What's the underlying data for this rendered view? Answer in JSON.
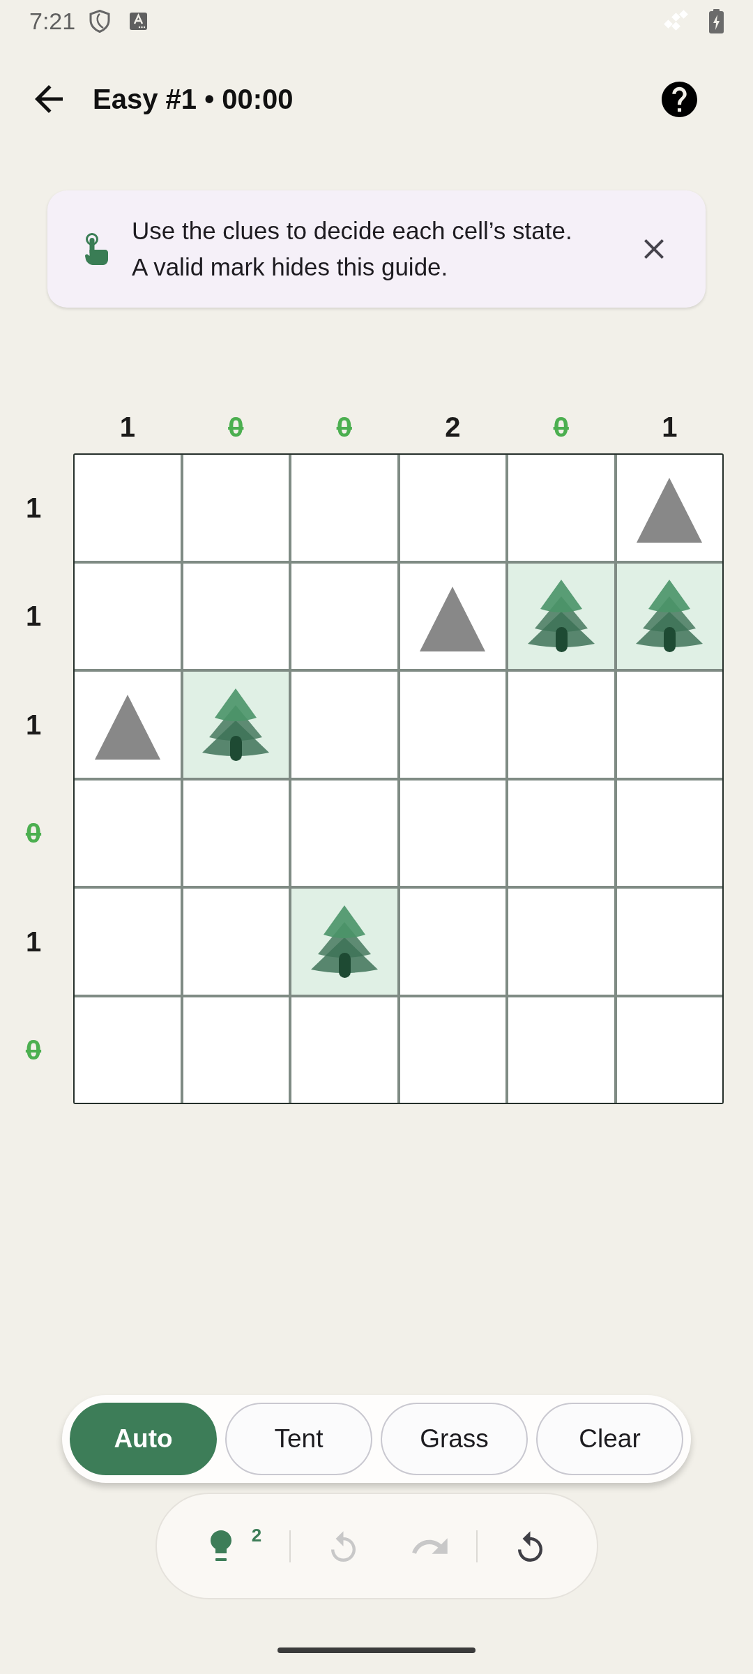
{
  "status_bar": {
    "time": "7:21"
  },
  "header": {
    "title": "Easy #1 • 00:00"
  },
  "guide": {
    "lines": [
      "Use the clues to decide each cell’s state.",
      "A valid mark hides this guide."
    ]
  },
  "board": {
    "column_clues": [
      {
        "value": "1",
        "satisfied": false
      },
      {
        "value": "0",
        "satisfied": true
      },
      {
        "value": "0",
        "satisfied": true
      },
      {
        "value": "2",
        "satisfied": false
      },
      {
        "value": "0",
        "satisfied": true
      },
      {
        "value": "1",
        "satisfied": false
      }
    ],
    "rows": [
      {
        "clue": {
          "value": "1",
          "satisfied": false
        },
        "cells": [
          {
            "kind": "empty"
          },
          {
            "kind": "empty"
          },
          {
            "kind": "empty"
          },
          {
            "kind": "empty"
          },
          {
            "kind": "empty"
          },
          {
            "kind": "tent"
          }
        ]
      },
      {
        "clue": {
          "value": "1",
          "satisfied": false
        },
        "cells": [
          {
            "kind": "empty"
          },
          {
            "kind": "empty"
          },
          {
            "kind": "empty"
          },
          {
            "kind": "tent"
          },
          {
            "kind": "tree"
          },
          {
            "kind": "tree"
          }
        ]
      },
      {
        "clue": {
          "value": "1",
          "satisfied": false
        },
        "cells": [
          {
            "kind": "tent"
          },
          {
            "kind": "tree"
          },
          {
            "kind": "empty"
          },
          {
            "kind": "empty"
          },
          {
            "kind": "empty"
          },
          {
            "kind": "empty"
          }
        ]
      },
      {
        "clue": {
          "value": "0",
          "satisfied": true
        },
        "cells": [
          {
            "kind": "empty"
          },
          {
            "kind": "empty"
          },
          {
            "kind": "empty"
          },
          {
            "kind": "empty"
          },
          {
            "kind": "empty"
          },
          {
            "kind": "empty"
          }
        ]
      },
      {
        "clue": {
          "value": "1",
          "satisfied": false
        },
        "cells": [
          {
            "kind": "empty"
          },
          {
            "kind": "empty"
          },
          {
            "kind": "tree"
          },
          {
            "kind": "empty"
          },
          {
            "kind": "empty"
          },
          {
            "kind": "empty"
          }
        ]
      },
      {
        "clue": {
          "value": "0",
          "satisfied": true
        },
        "cells": [
          {
            "kind": "empty"
          },
          {
            "kind": "empty"
          },
          {
            "kind": "empty"
          },
          {
            "kind": "empty"
          },
          {
            "kind": "empty"
          },
          {
            "kind": "empty"
          }
        ]
      }
    ]
  },
  "modes": [
    {
      "label": "Auto",
      "selected": true
    },
    {
      "label": "Tent",
      "selected": false
    },
    {
      "label": "Grass",
      "selected": false
    },
    {
      "label": "Clear",
      "selected": false
    }
  ],
  "action_groups": [
    [
      {
        "kind": "hint",
        "badge": "2",
        "disabled": false
      }
    ],
    [
      {
        "kind": "undo",
        "disabled": true
      },
      {
        "kind": "redo",
        "disabled": true
      }
    ],
    [
      {
        "kind": "restart",
        "disabled": false
      }
    ]
  ]
}
